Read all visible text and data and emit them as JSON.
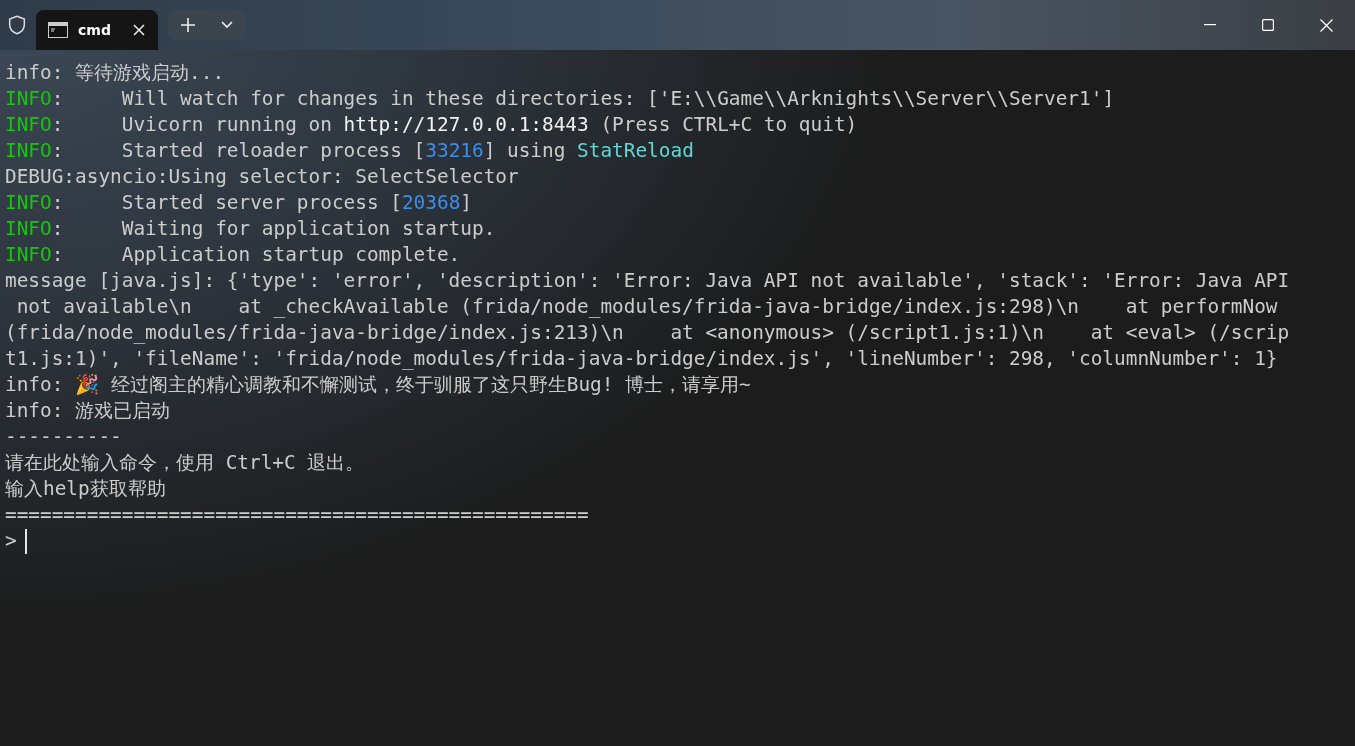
{
  "tabs": [
    {
      "label": "cmd",
      "selected": true
    }
  ],
  "terminal": {
    "lines": [
      [
        {
          "text": "info: 等待游戏启动...",
          "kind": "plain"
        }
      ],
      [
        {
          "text": "INFO",
          "kind": "level"
        },
        {
          "text": ":     Will watch for changes in these directories: ['E:\\\\Game\\\\Arknights\\\\Server\\\\Server1']",
          "kind": "plain"
        }
      ],
      [
        {
          "text": "INFO",
          "kind": "level"
        },
        {
          "text": ":     Uvicorn running on ",
          "kind": "plain"
        },
        {
          "text": "http://127.0.0.1:8443",
          "kind": "bright"
        },
        {
          "text": " (Press CTRL+C to quit)",
          "kind": "plain"
        }
      ],
      [
        {
          "text": "INFO",
          "kind": "level"
        },
        {
          "text": ":     Started reloader process [",
          "kind": "plain"
        },
        {
          "text": "33216",
          "kind": "number"
        },
        {
          "text": "] using ",
          "kind": "plain"
        },
        {
          "text": "StatReload",
          "kind": "accent"
        }
      ],
      [
        {
          "text": "DEBUG:asyncio:Using selector: SelectSelector",
          "kind": "plain"
        }
      ],
      [
        {
          "text": "INFO",
          "kind": "level"
        },
        {
          "text": ":     Started server process [",
          "kind": "plain"
        },
        {
          "text": "20368",
          "kind": "number"
        },
        {
          "text": "]",
          "kind": "plain"
        }
      ],
      [
        {
          "text": "INFO",
          "kind": "level"
        },
        {
          "text": ":     Waiting for application startup.",
          "kind": "plain"
        }
      ],
      [
        {
          "text": "INFO",
          "kind": "level"
        },
        {
          "text": ":     Application startup complete.",
          "kind": "plain"
        }
      ],
      [
        {
          "text": "message [java.js]: {'type': 'error', 'description': 'Error: Java API not available', 'stack': 'Error: Java API",
          "kind": "plain"
        }
      ],
      [
        {
          "text": " not available\\n    at _checkAvailable (frida/node_modules/frida-java-bridge/index.js:298)\\n    at performNow",
          "kind": "plain"
        }
      ],
      [
        {
          "text": "(frida/node_modules/frida-java-bridge/index.js:213)\\n    at <anonymous> (/script1.js:1)\\n    at <eval> (/scrip",
          "kind": "plain"
        }
      ],
      [
        {
          "text": "t1.js:1)', 'fileName': 'frida/node_modules/frida-java-bridge/index.js', 'lineNumber': 298, 'columnNumber': 1}",
          "kind": "plain"
        }
      ],
      [
        {
          "text": "info: 🎉 经过阁主的精心调教和不懈测试，终于驯服了这只野生Bug! 博士，请享用~",
          "kind": "plain"
        }
      ],
      [
        {
          "text": "info: 游戏已启动",
          "kind": "plain"
        }
      ],
      [
        {
          "text": "----------",
          "kind": "plain"
        }
      ],
      [
        {
          "text": "请在此处输入命令，使用 Ctrl+C 退出。",
          "kind": "plain"
        }
      ],
      [
        {
          "text": "输入help获取帮助",
          "kind": "plain"
        }
      ],
      [
        {
          "text": "==================================================",
          "kind": "plain"
        }
      ]
    ],
    "prompt": ">"
  }
}
